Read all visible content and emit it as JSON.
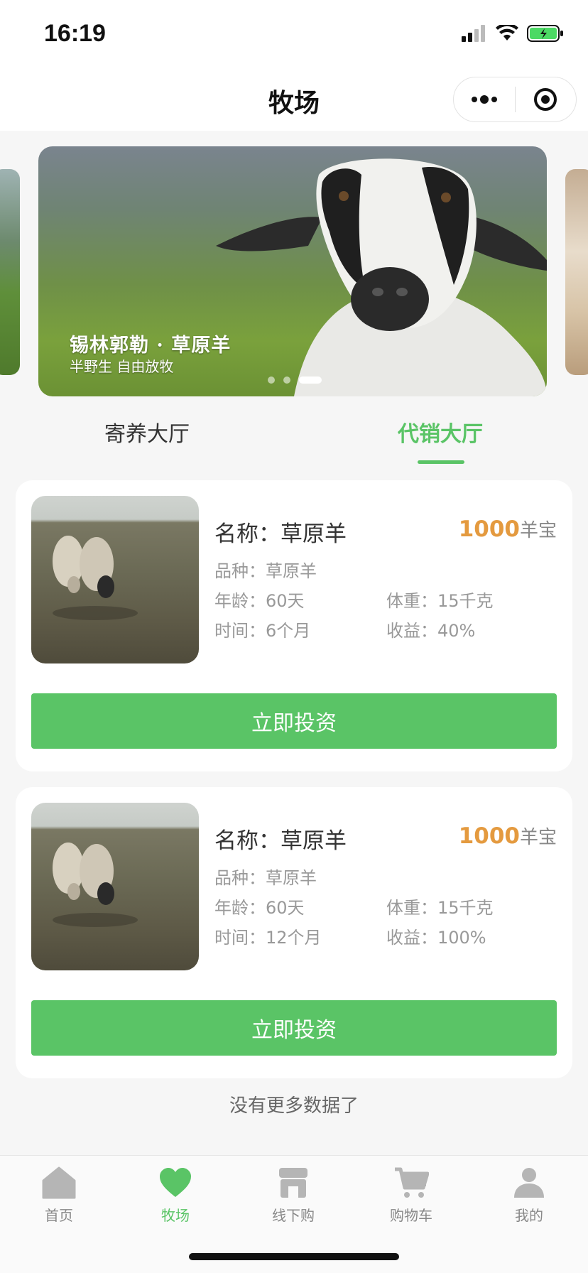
{
  "status": {
    "time": "16:19"
  },
  "nav": {
    "title": "牧场"
  },
  "banner": {
    "caption_title": "锡林郭勒 · 草原羊",
    "caption_subtitle": "半野生 自由放牧",
    "dots": 3,
    "active_dot": 3
  },
  "tabs": [
    {
      "label": "寄养大厅",
      "active": false
    },
    {
      "label": "代销大厅",
      "active": true
    }
  ],
  "cards": [
    {
      "name": "名称：草原羊",
      "price_value": "1000",
      "price_unit": "羊宝",
      "breed": "品种：草原羊",
      "age": "年龄：60天",
      "weight": "体重：15千克",
      "period": "时间：6个月",
      "yield": "收益：40%",
      "button": "立即投资"
    },
    {
      "name": "名称：草原羊",
      "price_value": "1000",
      "price_unit": "羊宝",
      "breed": "品种：草原羊",
      "age": "年龄：60天",
      "weight": "体重：15千克",
      "period": "时间：12个月",
      "yield": "收益：100%",
      "button": "立即投资"
    }
  ],
  "footer_text": "没有更多数据了",
  "tabbar": [
    {
      "label": "首页",
      "icon": "home-icon",
      "active": false
    },
    {
      "label": "牧场",
      "icon": "heart-icon",
      "active": true
    },
    {
      "label": "线下购",
      "icon": "store-icon",
      "active": false
    },
    {
      "label": "购物车",
      "icon": "cart-icon",
      "active": false
    },
    {
      "label": "我的",
      "icon": "user-icon",
      "active": false
    }
  ],
  "colors": {
    "accent": "#5ac466",
    "price": "#e49a3f",
    "background": "#f6f6f6"
  }
}
